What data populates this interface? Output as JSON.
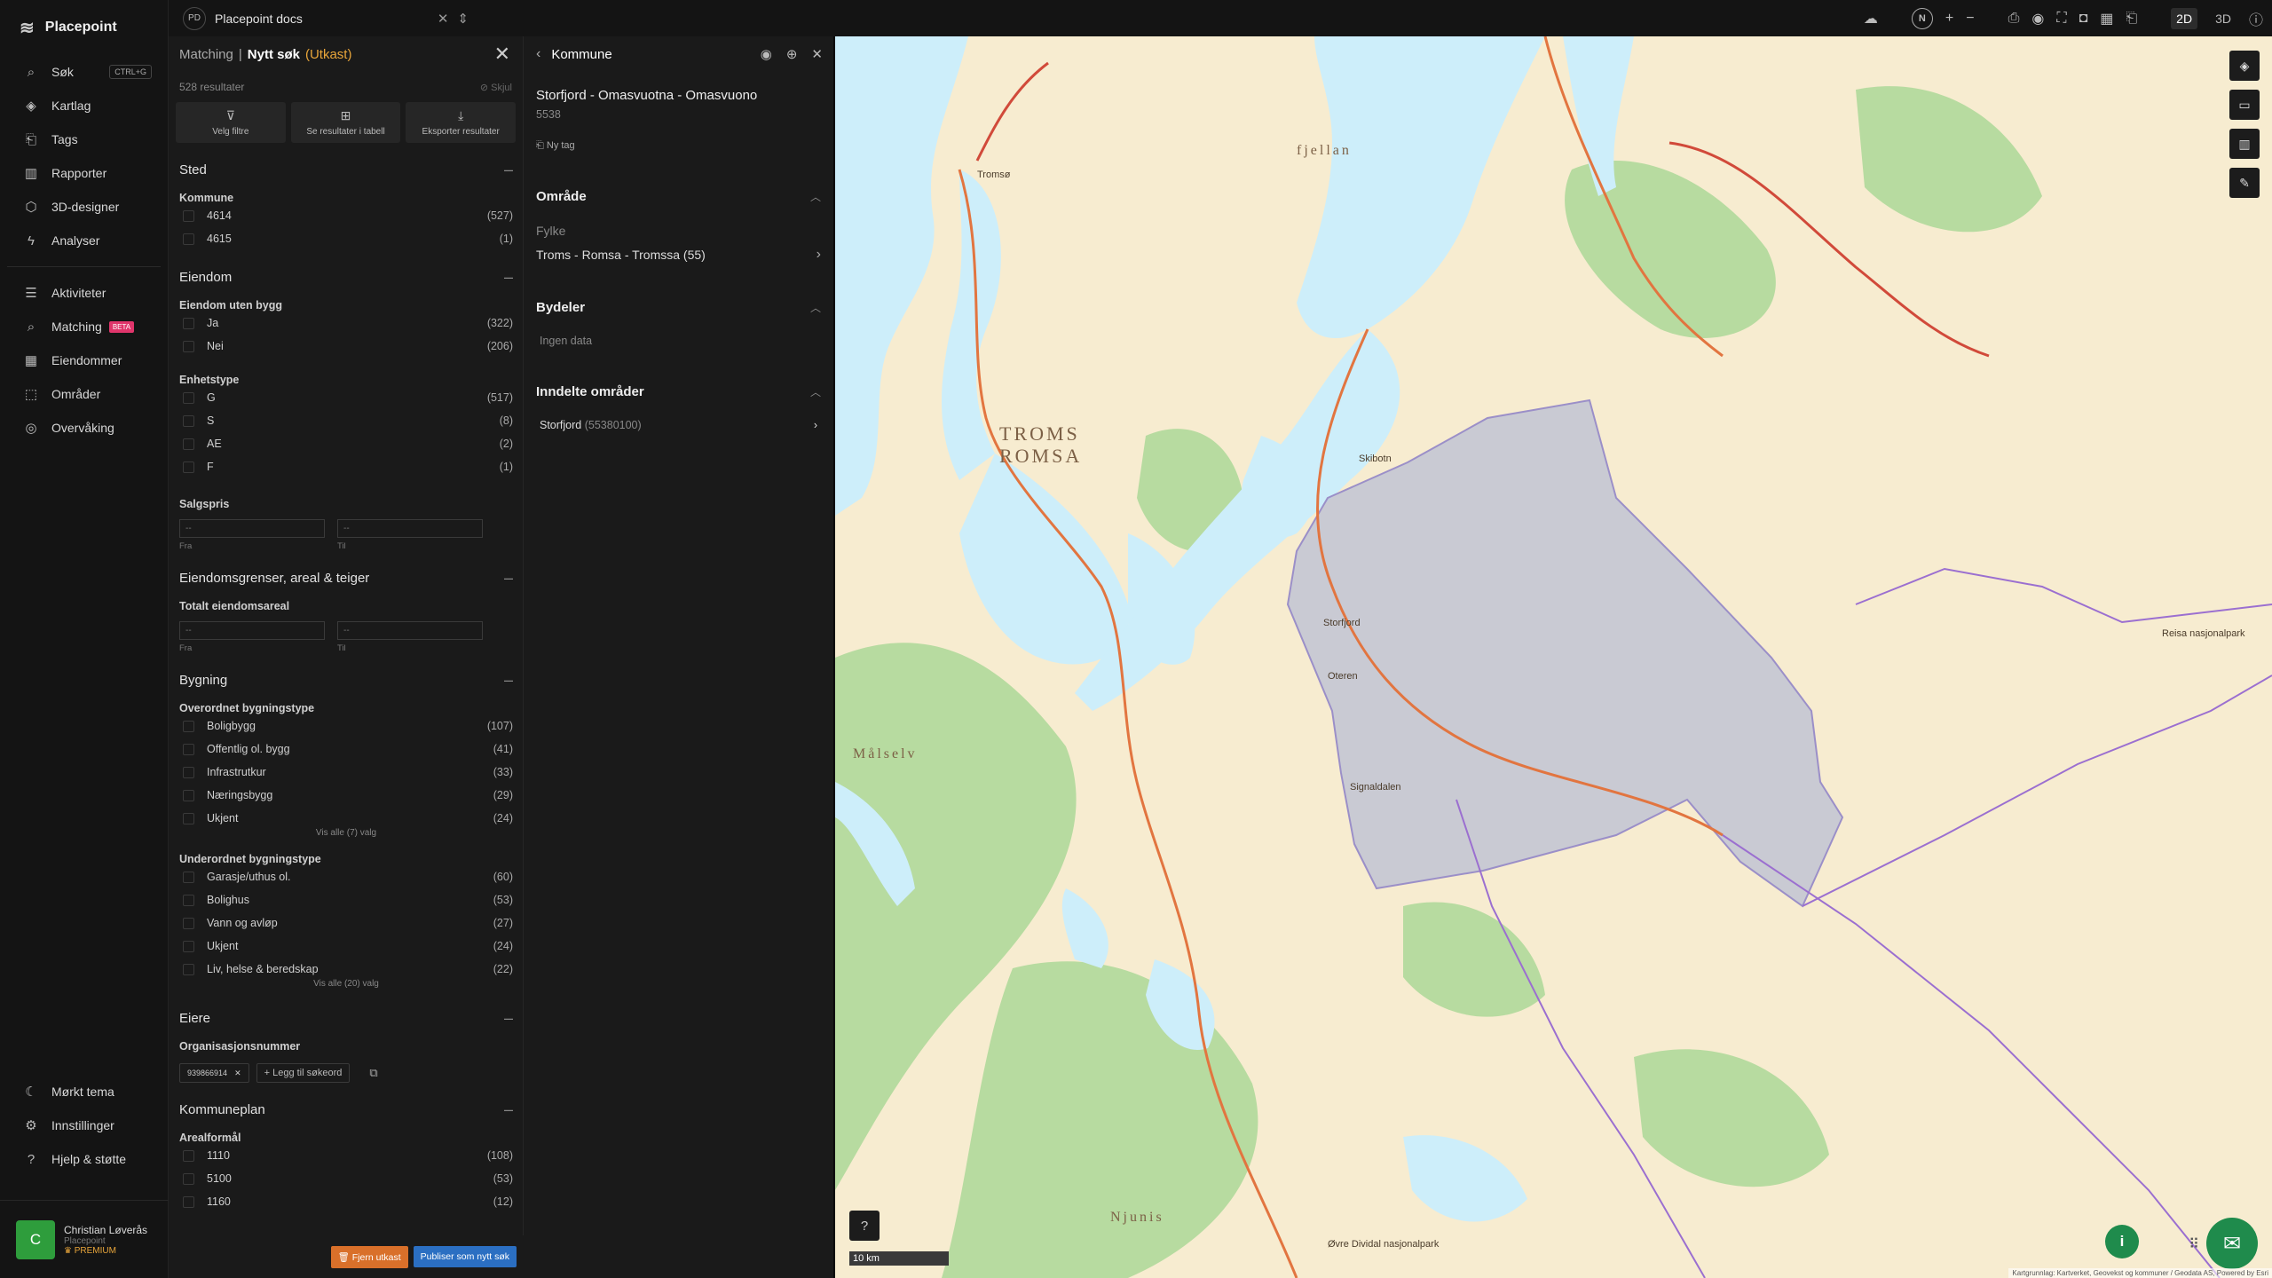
{
  "app": {
    "name": "Placepoint"
  },
  "workspace": {
    "badge": "PD",
    "name": "Placepoint docs"
  },
  "nav": {
    "items": [
      {
        "label": "Søk",
        "shortcut": "CTRL+G"
      },
      {
        "label": "Kartlag"
      },
      {
        "label": "Tags"
      },
      {
        "label": "Rapporter"
      },
      {
        "label": "3D-designer"
      },
      {
        "label": "Analyser"
      }
    ],
    "items2": [
      {
        "label": "Aktiviteter"
      },
      {
        "label": "Matching",
        "badge": "BETA"
      },
      {
        "label": "Eiendommer"
      },
      {
        "label": "Områder"
      },
      {
        "label": "Overvåking"
      }
    ],
    "bottom": [
      {
        "label": "Mørkt tema"
      },
      {
        "label": "Innstillinger"
      },
      {
        "label": "Hjelp & støtte"
      }
    ]
  },
  "user": {
    "initial": "C",
    "name": "Christian Løverås",
    "org": "Placepoint",
    "plan": "PREMIUM"
  },
  "toolbar": {
    "compass": "N",
    "mode2d": "2D",
    "mode3d": "3D"
  },
  "filter": {
    "crumb": "Matching",
    "sep": "|",
    "title": "Nytt søk",
    "status": "(Utkast)",
    "results": "528 resultater",
    "hide": "Skjul",
    "buttons": {
      "choose": "Velg filtre",
      "table": "Se resultater i tabell",
      "export": "Eksporter resultater"
    },
    "sted": {
      "title": "Sted",
      "kommune": "Kommune",
      "options": [
        {
          "label": "4614",
          "n": "(527)"
        },
        {
          "label": "4615",
          "n": "(1)"
        }
      ]
    },
    "eiendom": {
      "title": "Eiendom",
      "uten_bygg": "Eiendom uten bygg",
      "uten_opts": [
        {
          "label": "Ja",
          "n": "(322)"
        },
        {
          "label": "Nei",
          "n": "(206)"
        }
      ],
      "enhetstype": "Enhetstype",
      "enhet_opts": [
        {
          "label": "G",
          "n": "(517)"
        },
        {
          "label": "S",
          "n": "(8)"
        },
        {
          "label": "AE",
          "n": "(2)"
        },
        {
          "label": "F",
          "n": "(1)"
        }
      ],
      "salgspris": "Salgspris",
      "from_ph": "--",
      "to_ph": "--",
      "from": "Fra",
      "to": "Til"
    },
    "grenser": {
      "title": "Eiendomsgrenser, areal & teiger",
      "total": "Totalt eiendomsareal",
      "from_ph": "--",
      "to_ph": "--",
      "from": "Fra",
      "to": "Til"
    },
    "bygning": {
      "title": "Bygning",
      "overordnet": "Overordnet bygningstype",
      "over_opts": [
        {
          "label": "Boligbygg",
          "n": "(107)"
        },
        {
          "label": "Offentlig ol. bygg",
          "n": "(41)"
        },
        {
          "label": "Infrastrutkur",
          "n": "(33)"
        },
        {
          "label": "Næringsbygg",
          "n": "(29)"
        },
        {
          "label": "Ukjent",
          "n": "(24)"
        }
      ],
      "over_all": "Vis alle (7) valg",
      "underordnet": "Underordnet bygningstype",
      "under_opts": [
        {
          "label": "Garasje/uthus ol.",
          "n": "(60)"
        },
        {
          "label": "Bolighus",
          "n": "(53)"
        },
        {
          "label": "Vann og avløp",
          "n": "(27)"
        },
        {
          "label": "Ukjent",
          "n": "(24)"
        },
        {
          "label": "Liv, helse & beredskap",
          "n": "(22)"
        }
      ],
      "under_all": "Vis alle (20) valg"
    },
    "eiere": {
      "title": "Eiere",
      "orgnr": "Organisasjonsnummer",
      "chip": "939866914",
      "add": "+ Legg til søkeord"
    },
    "kommuneplan": {
      "title": "Kommuneplan",
      "areal": "Arealformål",
      "opts": [
        {
          "label": "1110",
          "n": "(108)"
        },
        {
          "label": "5100",
          "n": "(53)"
        },
        {
          "label": "1160",
          "n": "(12)"
        }
      ]
    },
    "footer": {
      "remove": "Fjern utkast",
      "publish": "Publiser som nytt søk"
    }
  },
  "kommune": {
    "header": "Kommune",
    "name": "Storfjord - Omasvuotna - Omasvuono",
    "code": "5538",
    "tag": "Ny tag",
    "omraade": "Område",
    "fylke_label": "Fylke",
    "fylke": "Troms - Romsa - Tromssa (55)",
    "bydeler": "Bydeler",
    "nodata": "Ingen data",
    "inndelte": "Inndelte områder",
    "child_name": "Storfjord",
    "child_code": "(55380100)"
  },
  "map": {
    "labels": {
      "region1": "TROMS",
      "region2": "ROMSA",
      "malselv": "Målselv",
      "njunis": "Njunis",
      "fjellan": "fjellan",
      "tromso": "Tromsø",
      "storfjord": "Storfjord",
      "oteren": "Oteren",
      "skibotn": "Skibotn",
      "signaldalen": "Signaldalen",
      "dividal": "Øvre Dividal nasjonalpark",
      "reisa": "Reisa nasjonalpark"
    },
    "scale": "10 km",
    "attribution": "Kartgrunnlag: Kartverket, Geovekst og kommuner / Geodata AS, Powered by Esri",
    "colors": {
      "land": "#f7ecd0",
      "water": "#cdeefa",
      "forest": "#b7dba0",
      "highlight": "#b9bfd4"
    }
  }
}
